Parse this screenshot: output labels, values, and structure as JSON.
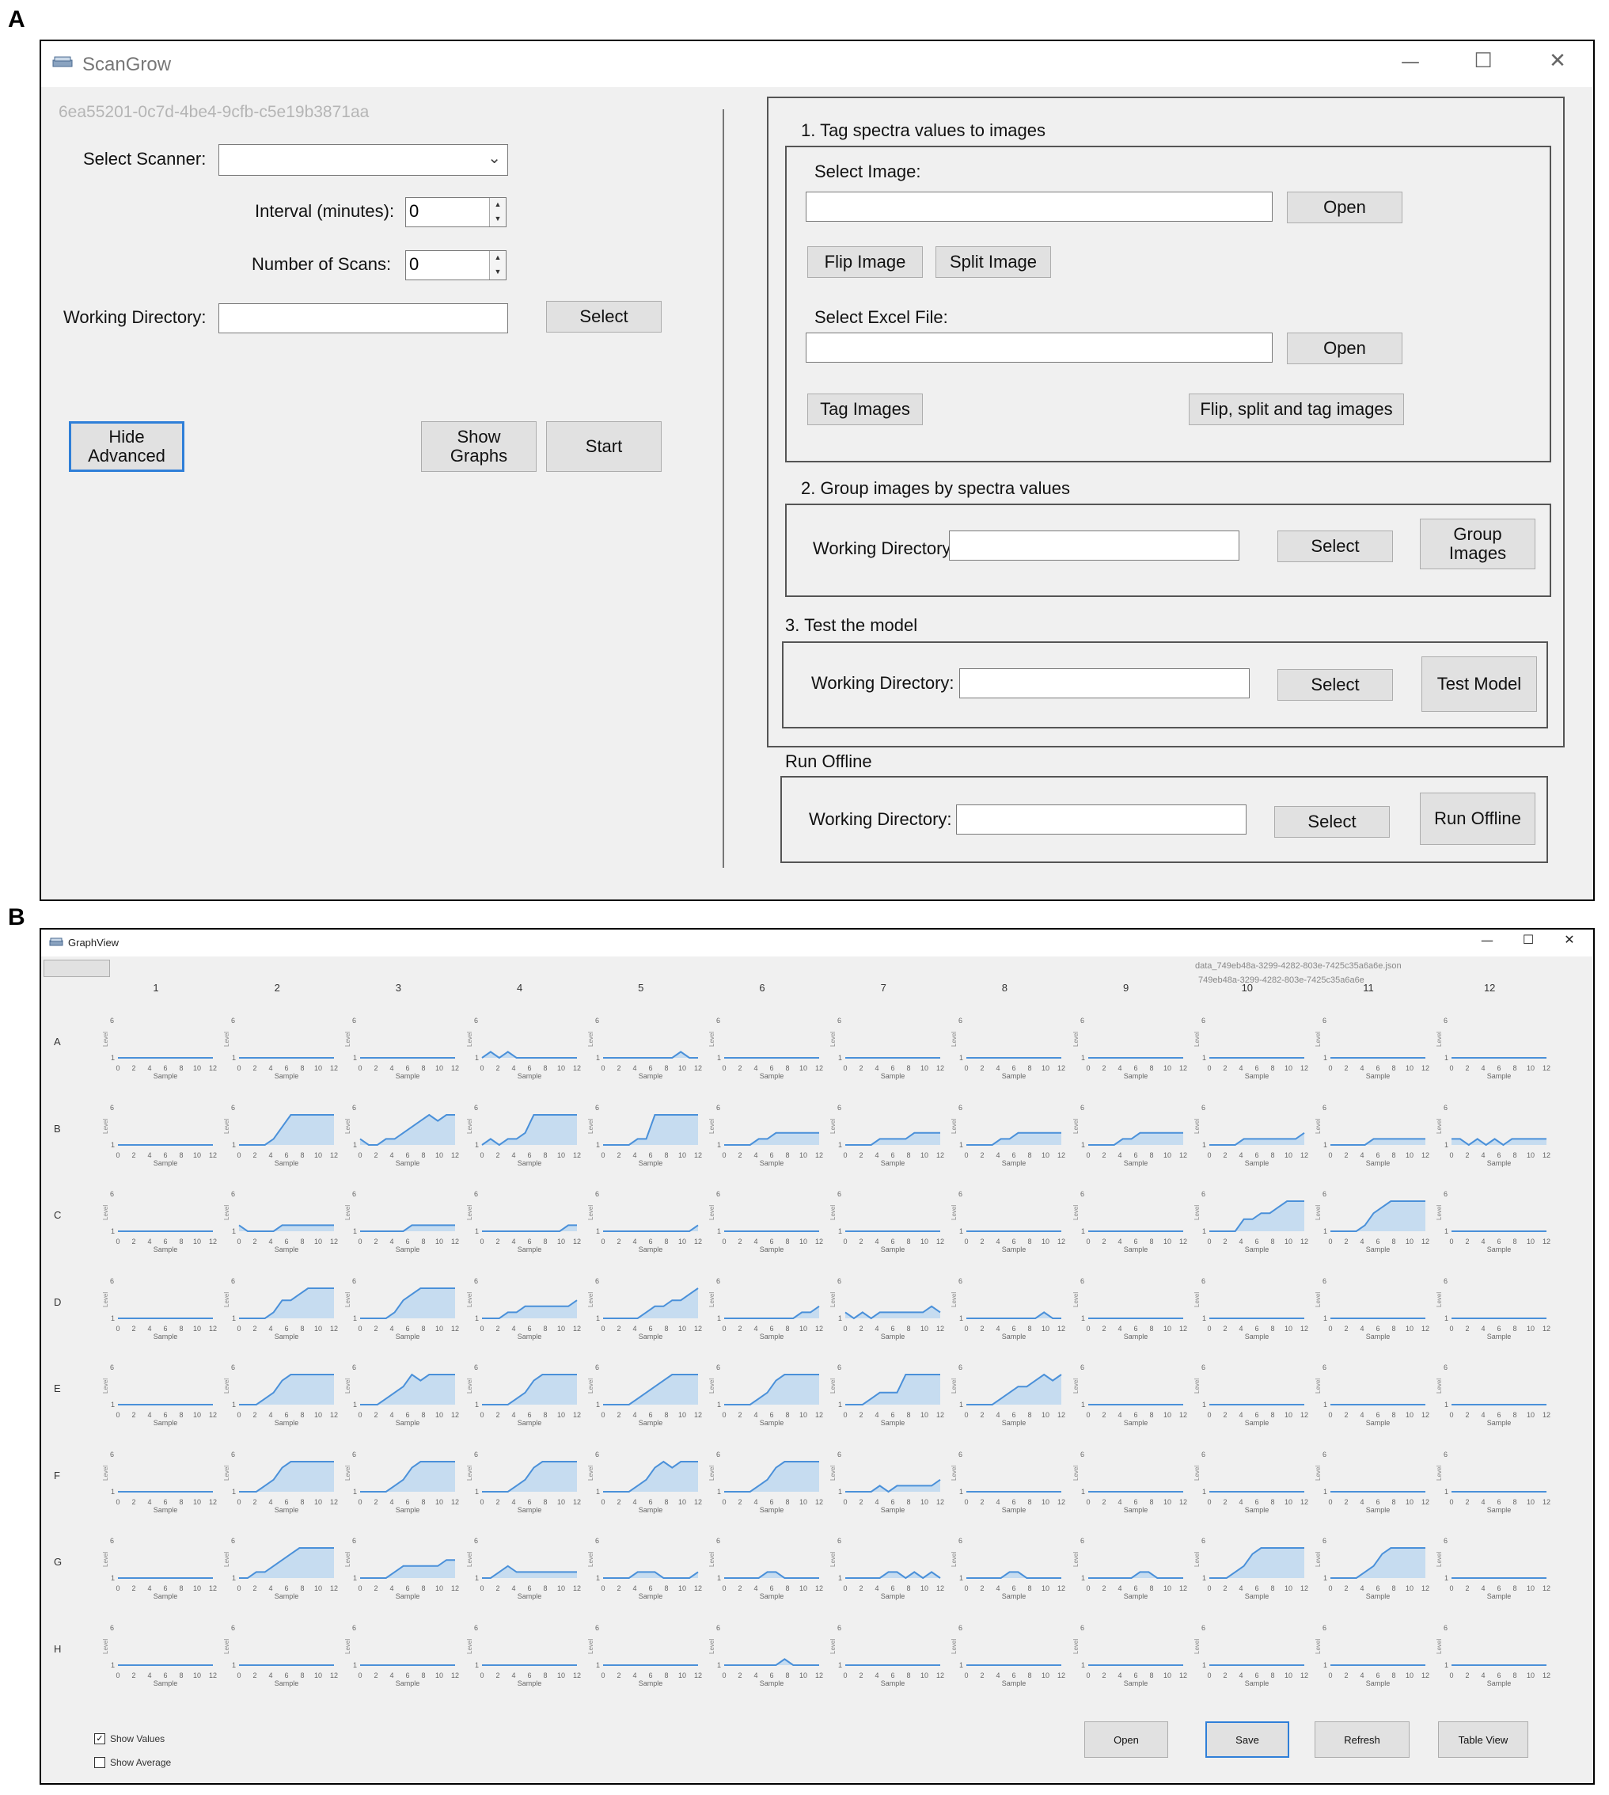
{
  "panel_labels": [
    "A",
    "B"
  ],
  "scangrow": {
    "title": "ScanGrow",
    "window_controls": [
      "—",
      "☐",
      "✕"
    ],
    "guid": "6ea55201-0c7d-4be4-9cfb-c5e19b3871aa",
    "select_scanner_label": "Select Scanner:",
    "scanner_value": "",
    "interval_label": "Interval (minutes):",
    "interval_value": "0",
    "num_scans_label": "Number of Scans:",
    "num_scans_value": "0",
    "working_dir_label": "Working Directory:",
    "select_button": "Select",
    "hide_advanced_button": "Hide\nAdvanced",
    "show_graphs_button": "Show\nGraphs",
    "start_button": "Start",
    "section1": {
      "title": "1. Tag spectra values to images",
      "select_image_label": "Select Image:",
      "open_button": "Open",
      "flip_button": "Flip Image",
      "split_button": "Split Image",
      "select_excel_label": "Select Excel File:",
      "open_button2": "Open",
      "tag_button": "Tag Images",
      "flip_split_tag_button": "Flip, split and tag images"
    },
    "section2": {
      "title": "2. Group images by spectra values",
      "working_dir_label": "Working Directory",
      "select_button": "Select",
      "group_button": "Group\nImages"
    },
    "section3": {
      "title": "3. Test the model",
      "working_dir_label": "Working Directory:",
      "select_button": "Select",
      "test_button": "Test Model"
    },
    "offline": {
      "title": "Run Offline",
      "working_dir_label": "Working Directory:",
      "select_button": "Select",
      "run_button": "Run Offline"
    }
  },
  "graphview": {
    "title": "GraphView",
    "window_controls": [
      "—",
      "☐",
      "✕"
    ],
    "file_name": "data_749eb48a-3299-4282-803e-7425c35a6a6e.json",
    "file_id": "749eb48a-3299-4282-803e-7425c35a6a6e",
    "columns": [
      "1",
      "2",
      "3",
      "4",
      "5",
      "6",
      "7",
      "8",
      "9",
      "10",
      "11",
      "12"
    ],
    "rows": [
      "A",
      "B",
      "C",
      "D",
      "E",
      "F",
      "G",
      "H"
    ],
    "y_label": "Level",
    "x_label": "Sample",
    "y_top_tick": "6",
    "y_bottom_tick": "1",
    "x_ticks": [
      "0",
      "2",
      "4",
      "6",
      "8",
      "10",
      "12"
    ],
    "show_values_label": "Show Values",
    "show_values_checked": "✓",
    "show_average_label": "Show Average",
    "buttons": {
      "open": "Open",
      "save": "Save",
      "refresh": "Refresh",
      "table_view": "Table View"
    },
    "accent_color": "#4a90d9",
    "fill_color": "#c6dcf0",
    "well_data": {
      "A": [
        [
          1,
          1,
          1,
          1,
          1,
          1,
          1,
          1,
          1,
          1,
          1,
          1
        ],
        [
          1,
          1,
          1,
          1,
          1,
          1,
          1,
          1,
          1,
          1,
          1,
          1
        ],
        [
          1,
          1,
          1,
          1,
          1,
          1,
          1,
          1,
          1,
          1,
          1,
          1
        ],
        [
          1,
          2,
          1,
          2,
          1,
          1,
          1,
          1,
          1,
          1,
          1,
          1
        ],
        [
          1,
          1,
          1,
          1,
          1,
          1,
          1,
          1,
          1,
          2,
          1,
          1
        ],
        [
          1,
          1,
          1,
          1,
          1,
          1,
          1,
          1,
          1,
          1,
          1,
          1
        ],
        [
          1,
          1,
          1,
          1,
          1,
          1,
          1,
          1,
          1,
          1,
          1,
          1
        ],
        [
          1,
          1,
          1,
          1,
          1,
          1,
          1,
          1,
          1,
          1,
          1,
          1
        ],
        [
          1,
          1,
          1,
          1,
          1,
          1,
          1,
          1,
          1,
          1,
          1,
          1
        ],
        [
          1,
          1,
          1,
          1,
          1,
          1,
          1,
          1,
          1,
          1,
          1,
          1
        ],
        [
          1,
          1,
          1,
          1,
          1,
          1,
          1,
          1,
          1,
          1,
          1,
          1
        ],
        [
          1,
          1,
          1,
          1,
          1,
          1,
          1,
          1,
          1,
          1,
          1,
          1
        ]
      ],
      "B": [
        [
          1,
          1,
          1,
          1,
          1,
          1,
          1,
          1,
          1,
          1,
          1,
          1
        ],
        [
          1,
          1,
          1,
          1,
          2,
          4,
          6,
          6,
          6,
          6,
          6,
          6
        ],
        [
          2,
          1,
          1,
          2,
          2,
          3,
          4,
          5,
          6,
          5,
          6,
          6
        ],
        [
          1,
          2,
          1,
          2,
          2,
          3,
          6,
          6,
          6,
          6,
          6,
          6
        ],
        [
          1,
          1,
          1,
          1,
          2,
          2,
          6,
          6,
          6,
          6,
          6,
          6
        ],
        [
          1,
          1,
          1,
          1,
          2,
          2,
          3,
          3,
          3,
          3,
          3,
          3
        ],
        [
          1,
          1,
          1,
          1,
          2,
          2,
          2,
          2,
          3,
          3,
          3,
          3
        ],
        [
          1,
          1,
          1,
          1,
          2,
          2,
          3,
          3,
          3,
          3,
          3,
          3
        ],
        [
          1,
          1,
          1,
          1,
          2,
          2,
          3,
          3,
          3,
          3,
          3,
          3
        ],
        [
          1,
          1,
          1,
          1,
          2,
          2,
          2,
          2,
          2,
          2,
          2,
          3
        ],
        [
          1,
          1,
          1,
          1,
          1,
          2,
          2,
          2,
          2,
          2,
          2,
          2
        ],
        [
          2,
          2,
          1,
          2,
          1,
          2,
          1,
          2,
          2,
          2,
          2,
          2
        ]
      ],
      "C": [
        [
          1,
          1,
          1,
          1,
          1,
          1,
          1,
          1,
          1,
          1,
          1,
          1
        ],
        [
          2,
          1,
          1,
          1,
          1,
          2,
          2,
          2,
          2,
          2,
          2,
          2
        ],
        [
          1,
          1,
          1,
          1,
          1,
          1,
          2,
          2,
          2,
          2,
          2,
          2
        ],
        [
          1,
          1,
          1,
          1,
          1,
          1,
          1,
          1,
          1,
          1,
          2,
          2
        ],
        [
          1,
          1,
          1,
          1,
          1,
          1,
          1,
          1,
          1,
          1,
          1,
          2
        ],
        [
          1,
          1,
          1,
          1,
          1,
          1,
          1,
          1,
          1,
          1,
          1,
          1
        ],
        [
          1,
          1,
          1,
          1,
          1,
          1,
          1,
          1,
          1,
          1,
          1,
          1
        ],
        [
          1,
          1,
          1,
          1,
          1,
          1,
          1,
          1,
          1,
          1,
          1,
          1
        ],
        [
          1,
          1,
          1,
          1,
          1,
          1,
          1,
          1,
          1,
          1,
          1,
          1
        ],
        [
          1,
          1,
          1,
          1,
          3,
          3,
          4,
          4,
          5,
          6,
          6,
          6
        ],
        [
          1,
          1,
          1,
          1,
          2,
          4,
          5,
          6,
          6,
          6,
          6,
          6
        ],
        [
          1,
          1,
          1,
          1,
          1,
          1,
          1,
          1,
          1,
          1,
          1,
          1
        ]
      ],
      "D": [
        [
          1,
          1,
          1,
          1,
          1,
          1,
          1,
          1,
          1,
          1,
          1,
          1
        ],
        [
          1,
          1,
          1,
          1,
          2,
          4,
          4,
          5,
          6,
          6,
          6,
          6
        ],
        [
          1,
          1,
          1,
          1,
          2,
          4,
          5,
          6,
          6,
          6,
          6,
          6
        ],
        [
          1,
          1,
          1,
          2,
          2,
          3,
          3,
          3,
          3,
          3,
          3,
          4
        ],
        [
          1,
          1,
          1,
          1,
          1,
          2,
          3,
          3,
          4,
          4,
          5,
          6
        ],
        [
          1,
          1,
          1,
          1,
          1,
          1,
          1,
          1,
          1,
          2,
          2,
          3
        ],
        [
          2,
          1,
          2,
          1,
          2,
          2,
          2,
          2,
          2,
          2,
          3,
          2
        ],
        [
          1,
          1,
          1,
          1,
          1,
          1,
          1,
          1,
          1,
          2,
          1,
          1
        ],
        [
          1,
          1,
          1,
          1,
          1,
          1,
          1,
          1,
          1,
          1,
          1,
          1
        ],
        [
          1,
          1,
          1,
          1,
          1,
          1,
          1,
          1,
          1,
          1,
          1,
          1
        ],
        [
          1,
          1,
          1,
          1,
          1,
          1,
          1,
          1,
          1,
          1,
          1,
          1
        ],
        [
          1,
          1,
          1,
          1,
          1,
          1,
          1,
          1,
          1,
          1,
          1,
          1
        ]
      ],
      "E": [
        [
          1,
          1,
          1,
          1,
          1,
          1,
          1,
          1,
          1,
          1,
          1,
          1
        ],
        [
          1,
          1,
          1,
          2,
          3,
          5,
          6,
          6,
          6,
          6,
          6,
          6
        ],
        [
          1,
          1,
          1,
          2,
          3,
          4,
          6,
          5,
          6,
          6,
          6,
          6
        ],
        [
          1,
          1,
          1,
          1,
          2,
          3,
          5,
          6,
          6,
          6,
          6,
          6
        ],
        [
          1,
          1,
          1,
          1,
          2,
          3,
          4,
          5,
          6,
          6,
          6,
          6
        ],
        [
          1,
          1,
          1,
          1,
          2,
          3,
          5,
          6,
          6,
          6,
          6,
          6
        ],
        [
          1,
          1,
          1,
          2,
          3,
          3,
          3,
          6,
          6,
          6,
          6,
          6
        ],
        [
          1,
          1,
          1,
          1,
          2,
          3,
          4,
          4,
          5,
          6,
          5,
          6
        ],
        [
          1,
          1,
          1,
          1,
          1,
          1,
          1,
          1,
          1,
          1,
          1,
          1
        ],
        [
          1,
          1,
          1,
          1,
          1,
          1,
          1,
          1,
          1,
          1,
          1,
          1
        ],
        [
          1,
          1,
          1,
          1,
          1,
          1,
          1,
          1,
          1,
          1,
          1,
          1
        ],
        [
          1,
          1,
          1,
          1,
          1,
          1,
          1,
          1,
          1,
          1,
          1,
          1
        ]
      ],
      "F": [
        [
          1,
          1,
          1,
          1,
          1,
          1,
          1,
          1,
          1,
          1,
          1,
          1
        ],
        [
          1,
          1,
          1,
          2,
          3,
          5,
          6,
          6,
          6,
          6,
          6,
          6
        ],
        [
          1,
          1,
          1,
          1,
          2,
          3,
          5,
          6,
          6,
          6,
          6,
          6
        ],
        [
          1,
          1,
          1,
          1,
          2,
          3,
          5,
          6,
          6,
          6,
          6,
          6
        ],
        [
          1,
          1,
          1,
          1,
          2,
          3,
          5,
          6,
          5,
          6,
          6,
          6
        ],
        [
          1,
          1,
          1,
          1,
          2,
          3,
          5,
          6,
          6,
          6,
          6,
          6
        ],
        [
          1,
          1,
          1,
          1,
          2,
          1,
          2,
          2,
          2,
          2,
          2,
          3
        ],
        [
          1,
          1,
          1,
          1,
          1,
          1,
          1,
          1,
          1,
          1,
          1,
          1
        ],
        [
          1,
          1,
          1,
          1,
          1,
          1,
          1,
          1,
          1,
          1,
          1,
          1
        ],
        [
          1,
          1,
          1,
          1,
          1,
          1,
          1,
          1,
          1,
          1,
          1,
          1
        ],
        [
          1,
          1,
          1,
          1,
          1,
          1,
          1,
          1,
          1,
          1,
          1,
          1
        ],
        [
          1,
          1,
          1,
          1,
          1,
          1,
          1,
          1,
          1,
          1,
          1,
          1
        ]
      ],
      "G": [
        [
          1,
          1,
          1,
          1,
          1,
          1,
          1,
          1,
          1,
          1,
          1,
          1
        ],
        [
          1,
          1,
          2,
          2,
          3,
          4,
          5,
          6,
          6,
          6,
          6,
          6
        ],
        [
          1,
          1,
          1,
          1,
          2,
          3,
          3,
          3,
          3,
          3,
          4,
          4
        ],
        [
          1,
          1,
          2,
          3,
          2,
          2,
          2,
          2,
          2,
          2,
          2,
          2
        ],
        [
          1,
          1,
          1,
          1,
          2,
          2,
          2,
          1,
          1,
          1,
          1,
          2
        ],
        [
          1,
          1,
          1,
          1,
          1,
          2,
          2,
          1,
          1,
          1,
          1,
          1
        ],
        [
          1,
          1,
          1,
          1,
          1,
          2,
          2,
          1,
          2,
          1,
          2,
          1
        ],
        [
          1,
          1,
          1,
          1,
          1,
          2,
          2,
          1,
          1,
          1,
          1,
          1
        ],
        [
          1,
          1,
          1,
          1,
          1,
          1,
          2,
          2,
          1,
          1,
          1,
          1
        ],
        [
          1,
          1,
          1,
          2,
          3,
          5,
          6,
          6,
          6,
          6,
          6,
          6
        ],
        [
          1,
          1,
          1,
          1,
          2,
          3,
          5,
          6,
          6,
          6,
          6,
          6
        ],
        [
          1,
          1,
          1,
          1,
          1,
          1,
          1,
          1,
          1,
          1,
          1,
          1
        ]
      ],
      "H": [
        [
          1,
          1,
          1,
          1,
          1,
          1,
          1,
          1,
          1,
          1,
          1,
          1
        ],
        [
          1,
          1,
          1,
          1,
          1,
          1,
          1,
          1,
          1,
          1,
          1,
          1
        ],
        [
          1,
          1,
          1,
          1,
          1,
          1,
          1,
          1,
          1,
          1,
          1,
          1
        ],
        [
          1,
          1,
          1,
          1,
          1,
          1,
          1,
          1,
          1,
          1,
          1,
          1
        ],
        [
          1,
          1,
          1,
          1,
          1,
          1,
          1,
          1,
          1,
          1,
          1,
          1
        ],
        [
          1,
          1,
          1,
          1,
          1,
          1,
          1,
          2,
          1,
          1,
          1,
          1
        ],
        [
          1,
          1,
          1,
          1,
          1,
          1,
          1,
          1,
          1,
          1,
          1,
          1
        ],
        [
          1,
          1,
          1,
          1,
          1,
          1,
          1,
          1,
          1,
          1,
          1,
          1
        ],
        [
          1,
          1,
          1,
          1,
          1,
          1,
          1,
          1,
          1,
          1,
          1,
          1
        ],
        [
          1,
          1,
          1,
          1,
          1,
          1,
          1,
          1,
          1,
          1,
          1,
          1
        ],
        [
          1,
          1,
          1,
          1,
          1,
          1,
          1,
          1,
          1,
          1,
          1,
          1
        ],
        [
          1,
          1,
          1,
          1,
          1,
          1,
          1,
          1,
          1,
          1,
          1,
          1
        ]
      ]
    }
  }
}
